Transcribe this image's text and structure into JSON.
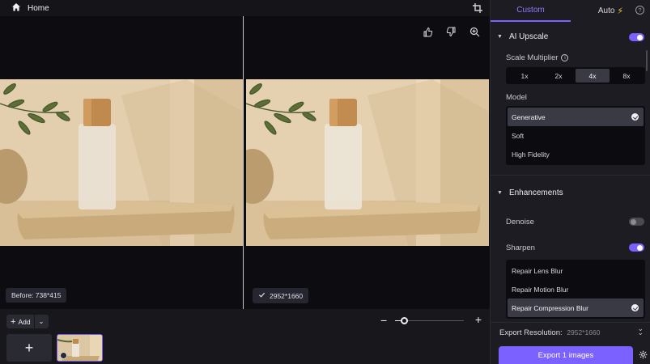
{
  "topbar": {
    "home_label": "Home"
  },
  "canvas": {
    "before_badge": "Before: 738*415",
    "after_badge": "2952*1660"
  },
  "bottom": {
    "add_label": "Add",
    "zoom_level": 0.1
  },
  "panel": {
    "tabs": [
      {
        "label": "Custom",
        "active": true
      },
      {
        "label": "Auto",
        "active": false
      }
    ],
    "ai_upscale": {
      "title": "AI Upscale",
      "enabled": true,
      "scale_label": "Scale Multiplier",
      "scales": [
        "1x",
        "2x",
        "4x",
        "8x"
      ],
      "selected_scale": "4x",
      "model_label": "Model",
      "models": [
        "Generative",
        "Soft",
        "High Fidelity"
      ],
      "selected_model": "Generative"
    },
    "enhancements": {
      "title": "Enhancements",
      "denoise_label": "Denoise",
      "denoise_enabled": false,
      "sharpen_label": "Sharpen",
      "sharpen_enabled": true,
      "sharpen_options": [
        "Repair Lens Blur",
        "Repair Motion Blur",
        "Repair Compression Blur"
      ],
      "selected_sharpen": "Repair Compression Blur"
    },
    "footer": {
      "export_resolution_label": "Export Resolution:",
      "export_resolution_value": "2952*1660",
      "export_button": "Export 1 images"
    }
  },
  "colors": {
    "accent": "#7b61ff",
    "bg": "#141419",
    "panel": "#1c1c22"
  }
}
